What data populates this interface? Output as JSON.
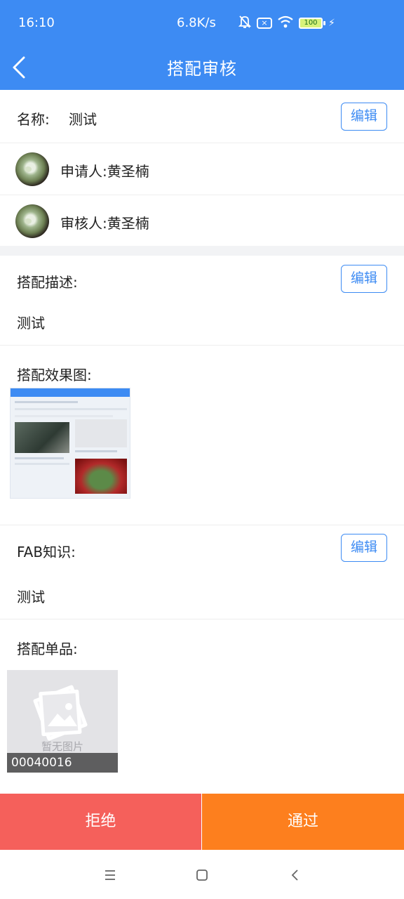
{
  "status_bar": {
    "time": "16:10",
    "network_speed": "6.8K/s",
    "battery": "100"
  },
  "header": {
    "title": "搭配审核",
    "back_icon": "chevron-left-icon",
    "color": "#3d8bf3"
  },
  "name_row": {
    "label": "名称:",
    "value": "测试",
    "edit_label": "编辑"
  },
  "applicant": {
    "label": "申请人:黄圣楠"
  },
  "reviewer": {
    "label": "审核人:黄圣楠"
  },
  "description": {
    "label": "搭配描述:",
    "value": "测试",
    "edit_label": "编辑"
  },
  "effect_image": {
    "label": "搭配效果图:"
  },
  "fab": {
    "label": "FAB知识:",
    "value": "测试",
    "edit_label": "编辑"
  },
  "items": {
    "label": "搭配单品:",
    "list": [
      {
        "placeholder_text": "暂无图片",
        "code": "00040016"
      }
    ]
  },
  "actions": {
    "reject_label": "拒绝",
    "approve_label": "通过",
    "reject_color": "#f5605b",
    "approve_color": "#fd7f1e"
  },
  "system_nav": {
    "icons": [
      "menu-icon",
      "home-square-icon",
      "back-chevron-icon"
    ]
  }
}
